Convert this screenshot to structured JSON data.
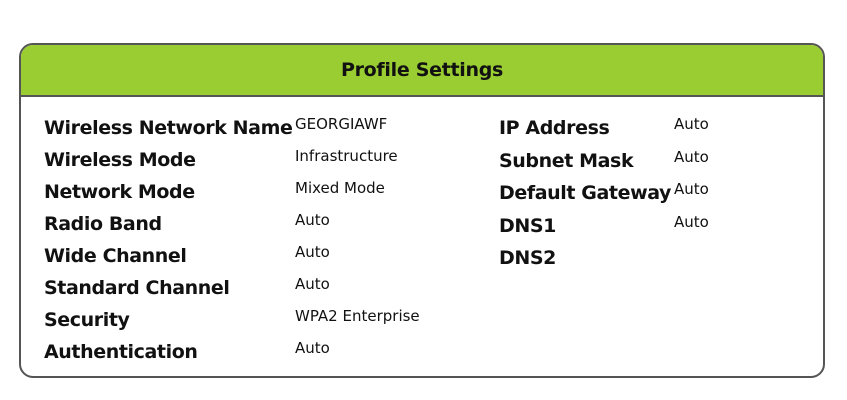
{
  "header": {
    "title": "Profile Settings"
  },
  "left_fields": [
    {
      "label": "Wireless Network Name",
      "value": "GEORGIAWF"
    },
    {
      "label": "Wireless Mode",
      "value": "Infrastructure"
    },
    {
      "label": "Network Mode",
      "value": "Mixed Mode"
    },
    {
      "label": "Radio Band",
      "value": "Auto"
    },
    {
      "label": "Wide Channel",
      "value": "Auto"
    },
    {
      "label": "Standard Channel",
      "value": "Auto"
    },
    {
      "label": "Security",
      "value": "WPA2 Enterprise"
    },
    {
      "label": "Authentication",
      "value": "Auto"
    }
  ],
  "right_fields": [
    {
      "label": "IP Address",
      "value": "Auto"
    },
    {
      "label": "Subnet Mask",
      "value": "Auto"
    },
    {
      "label": "Default Gateway",
      "value": "Auto"
    },
    {
      "label": "DNS1",
      "value": "Auto"
    },
    {
      "label": "DNS2",
      "value": ""
    }
  ],
  "colors": {
    "header_bg": "#9acd32",
    "border": "#555555",
    "text": "#111111"
  }
}
